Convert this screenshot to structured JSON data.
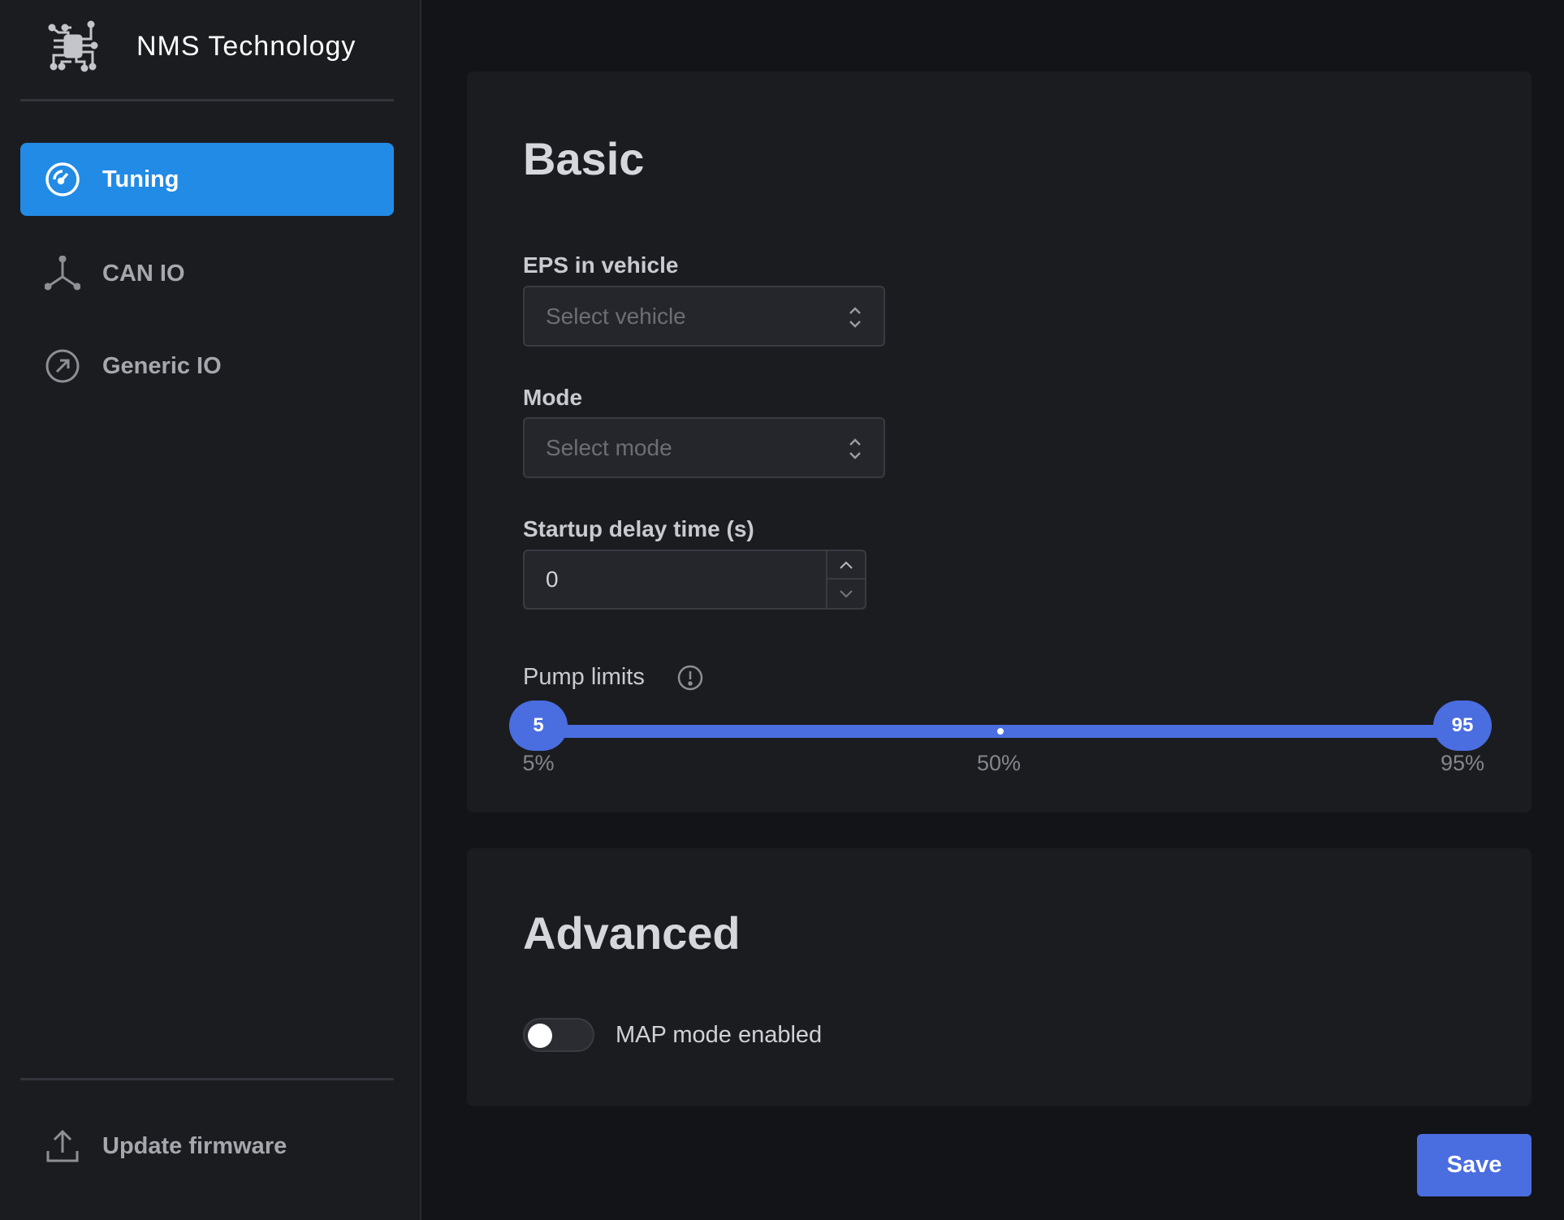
{
  "brand": {
    "name": "NMS Technology",
    "logo_icon": "circuit-chip-icon"
  },
  "sidebar": {
    "items": [
      {
        "label": "Tuning",
        "icon": "gauge-icon",
        "active": true
      },
      {
        "label": "CAN IO",
        "icon": "network-icon",
        "active": false
      },
      {
        "label": "Generic IO",
        "icon": "arrow-up-right-circle-icon",
        "active": false
      }
    ],
    "footer": {
      "label": "Update firmware",
      "icon": "upload-icon"
    }
  },
  "basic": {
    "title": "Basic",
    "eps": {
      "label": "EPS in vehicle",
      "placeholder": "Select vehicle"
    },
    "mode": {
      "label": "Mode",
      "placeholder": "Select mode"
    },
    "startup": {
      "label": "Startup delay time (s)",
      "value": "0"
    },
    "pump": {
      "label": "Pump limits",
      "min_value": "5",
      "max_value": "95",
      "min": 5,
      "max": 95,
      "ticks": [
        "5%",
        "50%",
        "95%"
      ]
    }
  },
  "advanced": {
    "title": "Advanced",
    "map_mode": {
      "label": "MAP mode enabled",
      "enabled": false
    }
  },
  "save_label": "Save",
  "colors": {
    "accent": "#228be6",
    "slider": "#4a6de0"
  }
}
